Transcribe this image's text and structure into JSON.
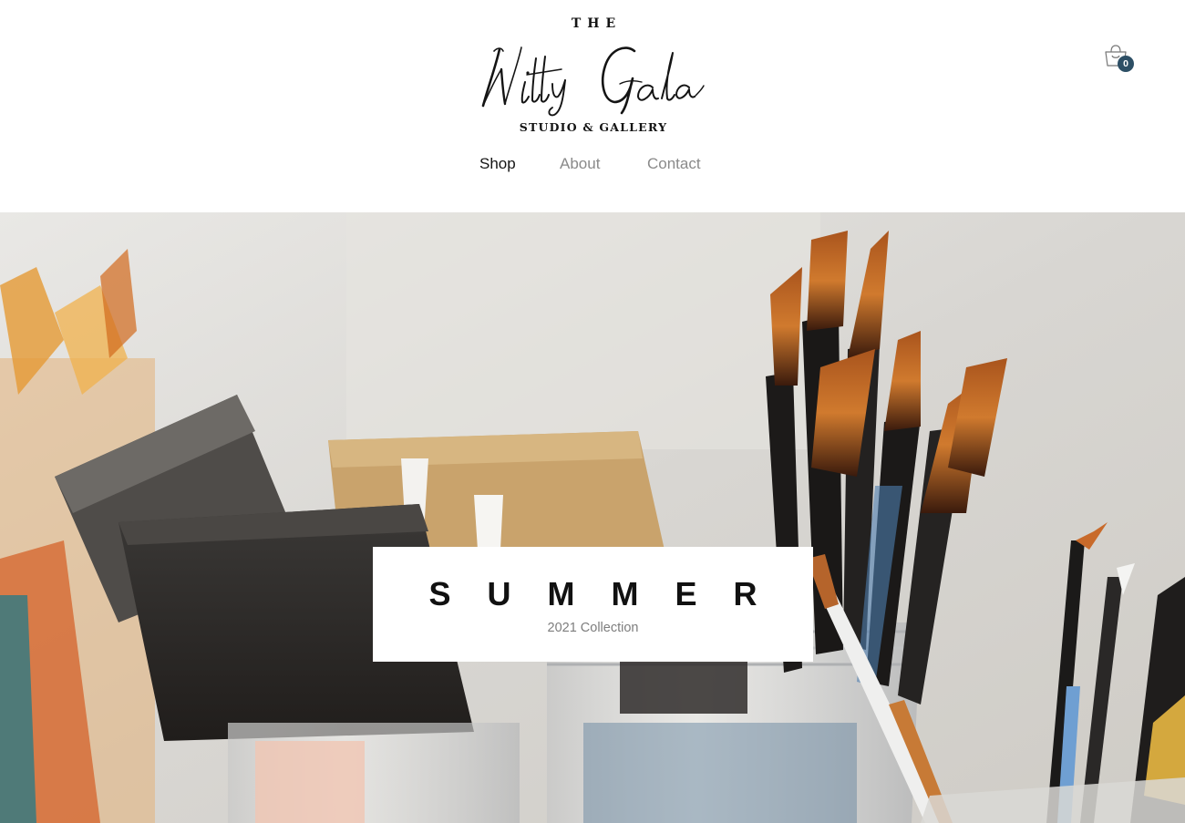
{
  "header": {
    "logo": {
      "top_text": "THE",
      "script_text": "Witty Gala",
      "sub_text": "STUDIO & GALLERY"
    },
    "nav": {
      "items": [
        {
          "label": "Shop",
          "active": true
        },
        {
          "label": "About",
          "active": false
        },
        {
          "label": "Contact",
          "active": false
        }
      ]
    },
    "cart": {
      "icon": "shopping-bag-icon",
      "count": "0",
      "badge_color": "#2d4f65"
    }
  },
  "hero": {
    "image": "paint-brushes-in-jars-photo",
    "collection": {
      "title": "SUMMER",
      "subtitle": "2021 Collection"
    }
  },
  "colors": {
    "text_primary": "#141414",
    "nav_inactive": "#8a8a8a",
    "accent": "#2d4f65"
  }
}
